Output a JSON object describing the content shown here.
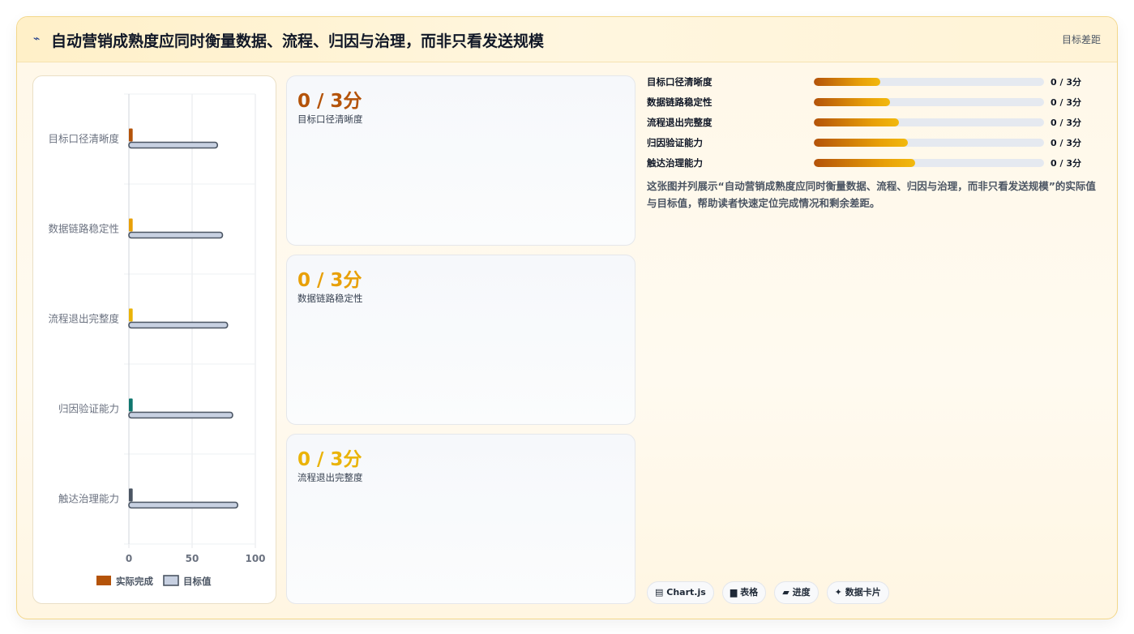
{
  "header": {
    "title": "自动营销成熟度应同时衡量数据、流程、归因与治理，而非只看发送规模",
    "tag": "目标差距"
  },
  "chart_data": {
    "type": "bar",
    "orientation": "horizontal",
    "categories": [
      "目标口径清晰度",
      "数据链路稳定性",
      "流程退出完整度",
      "归因验证能力",
      "触达治理能力"
    ],
    "series": [
      {
        "name": "实际完成",
        "values": [
          3,
          3,
          3,
          3,
          3
        ],
        "colors": [
          "#b45309",
          "#e8a008",
          "#eab308",
          "#0f766e",
          "#4b5563"
        ]
      },
      {
        "name": "目标值",
        "values": [
          70,
          74,
          78,
          82,
          86
        ],
        "color": "#c7d0e1",
        "border": "#4b5563"
      }
    ],
    "xlim": [
      0,
      100
    ],
    "xticks": [
      "0",
      "50",
      "100"
    ],
    "grid": true,
    "legend": "bottom"
  },
  "kpis": [
    {
      "value": "0 / 3分",
      "label": "目标口径清晰度",
      "color": "#b45309"
    },
    {
      "value": "0 / 3分",
      "label": "数据链路稳定性",
      "color": "#e8a008"
    },
    {
      "value": "0 / 3分",
      "label": "流程退出完整度",
      "color": "#eab308"
    }
  ],
  "progress": [
    {
      "label": "目标口径清晰度",
      "value": "0 / 3分",
      "fill": 0.29
    },
    {
      "label": "数据链路稳定性",
      "value": "0 / 3分",
      "fill": 0.33
    },
    {
      "label": "流程退出完整度",
      "value": "0 / 3分",
      "fill": 0.37
    },
    {
      "label": "归因验证能力",
      "value": "0 / 3分",
      "fill": 0.41
    },
    {
      "label": "触达治理能力",
      "value": "0 / 3分",
      "fill": 0.44
    }
  ],
  "description": "这张图并列展示“自动营销成熟度应同时衡量数据、流程、归因与治理，而非只看发送规模”的实际值与目标值，帮助读者快速定位完成情况和剩余差距。",
  "chips": [
    {
      "icon": "chart-icon",
      "glyph": "▤",
      "label": "Chart.js"
    },
    {
      "icon": "table-icon",
      "glyph": "▆",
      "label": "表格"
    },
    {
      "icon": "progress-icon",
      "glyph": "▰",
      "label": "进度"
    },
    {
      "icon": "sparkle-icon",
      "glyph": "✦",
      "label": "数据卡片"
    }
  ]
}
